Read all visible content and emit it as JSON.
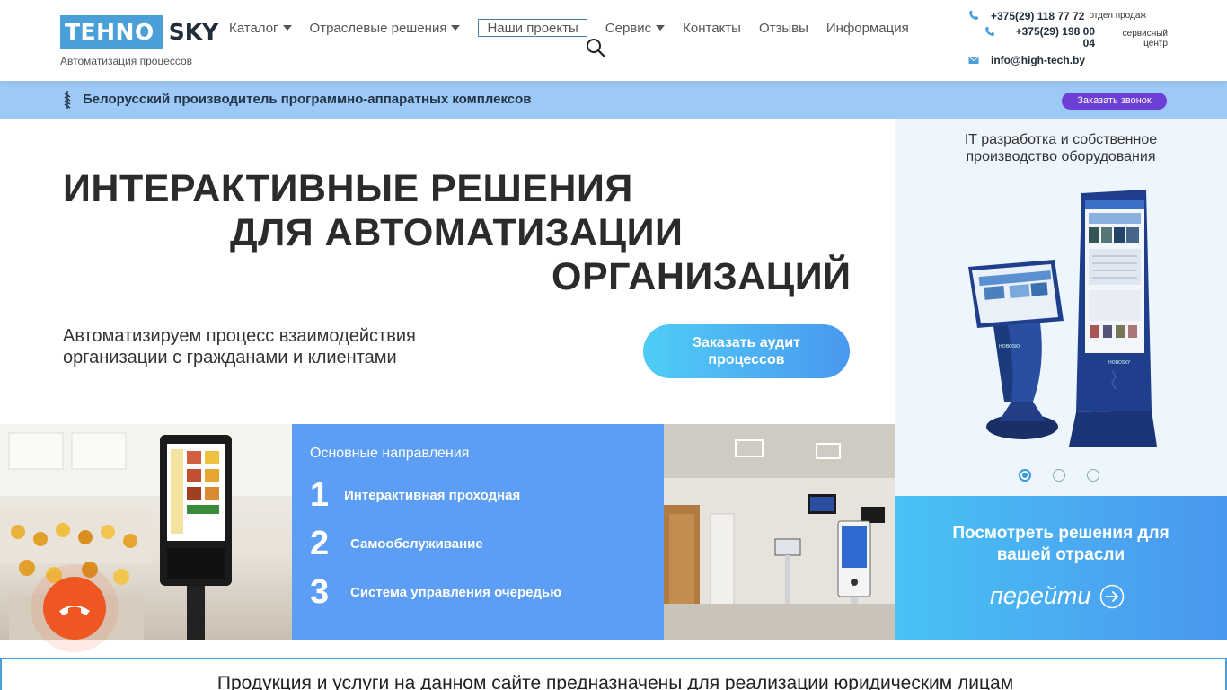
{
  "header": {
    "logo_part1": "TEHNO",
    "logo_part2": "SKY",
    "logo_subtitle": "Автоматизация процессов",
    "nav": [
      {
        "label": "Каталог",
        "has_dropdown": true
      },
      {
        "label": "Отраслевые решения",
        "has_dropdown": true
      },
      {
        "label": "Наши проекты",
        "has_dropdown": false
      },
      {
        "label": "Сервис",
        "has_dropdown": true
      },
      {
        "label": "Контакты",
        "has_dropdown": false
      },
      {
        "label": "Отзывы",
        "has_dropdown": false
      },
      {
        "label": "Информация",
        "has_dropdown": false
      }
    ],
    "contacts": {
      "phone1": "+375(29) 118 77 72",
      "phone1_note": "отдел продаж",
      "phone2_line1": "+375(29) 198 00",
      "phone2_line2": "04",
      "phone2_note_line1": "сервисный",
      "phone2_note_line2": "центр",
      "email": "info@high-tech.by"
    }
  },
  "strip": {
    "text": "Белорусский производитель программно-аппаратных комплексов",
    "callback_label": "Заказать звонок"
  },
  "hero": {
    "title_line1": "ИНТЕРАКТИВНЫЕ РЕШЕНИЯ",
    "title_line2": "ДЛЯ АВТОМАТИЗАЦИИ",
    "title_line3": "ОРГАНИЗАЦИЙ",
    "subtitle_line1": "Автоматизируем процесс взаимодействия",
    "subtitle_line2": "организации с гражданами и клиентами",
    "audit_line1": "Заказать аудит",
    "audit_line2": "процессов"
  },
  "slider": {
    "caption_line1": "IT разработка и собственное",
    "caption_line2": "производство оборудования",
    "kiosk_brand": "HOBOSKY",
    "dots": 3,
    "active_dot": 1
  },
  "directions": {
    "heading": "Основные направления",
    "items": [
      {
        "num": "1",
        "label": "Интерактивная проходная"
      },
      {
        "num": "2",
        "label": "Самообслуживание"
      },
      {
        "num": "3",
        "label": "Система управления очередью"
      }
    ]
  },
  "cta": {
    "title_line1": "Посмотреть решения для",
    "title_line2": "вашей отрасли",
    "link_label": "перейти"
  },
  "notice": {
    "text": "Продукция и услуги на данном сайте предназначены для реализации юридическим лицам"
  },
  "colors": {
    "brand_blue": "#4a9fd8",
    "strip_bg": "#9cc9f5",
    "callback_purple": "#6c3fd6",
    "directions_bg": "#5c9ef5",
    "call_orange": "#ee5622"
  }
}
